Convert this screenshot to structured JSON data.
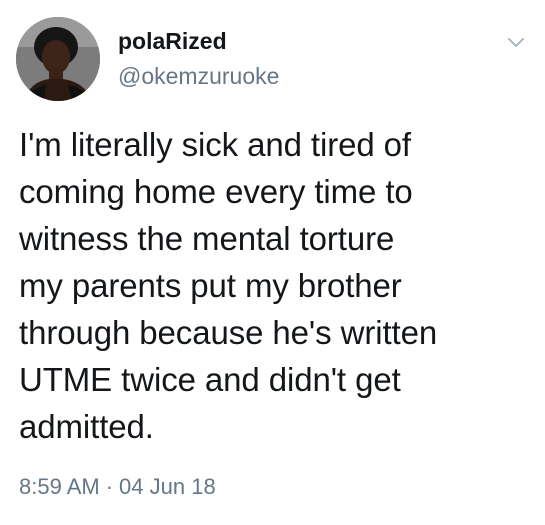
{
  "tweet": {
    "display_name": "polaRized",
    "handle": "@okemzuruoke",
    "text": "I'm literally sick and tired of\ncoming home every time to\nwitness the mental torture\nmy parents put my brother\nthrough because he's written\nUTME twice and didn't get\nadmitted.",
    "time": "8:59 AM",
    "separator": "·",
    "date": "04 Jun 18"
  },
  "icons": {
    "avatar": "profile-photo",
    "menu": "chevron-down-icon"
  },
  "colors": {
    "text_primary": "#14171a",
    "text_secondary": "#657786",
    "background": "#ffffff"
  }
}
